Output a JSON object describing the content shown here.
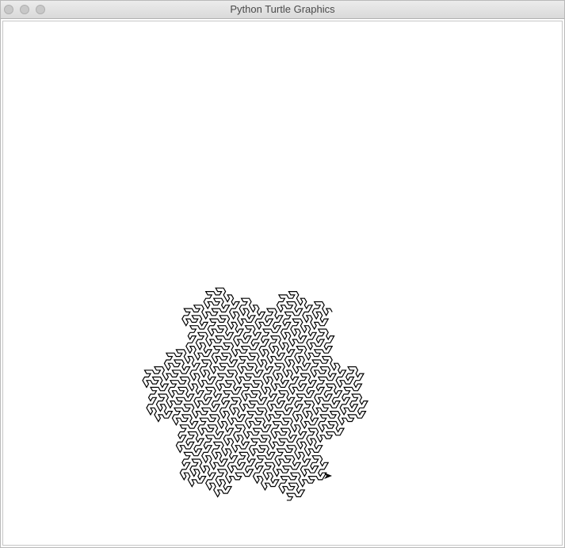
{
  "window": {
    "title": "Python Turtle Graphics"
  },
  "colors": {
    "pen": "#000000",
    "canvas_background": "#ffffff"
  },
  "drawing": {
    "shape": "gosper-curve",
    "turtle_icon": "arrow-icon"
  }
}
